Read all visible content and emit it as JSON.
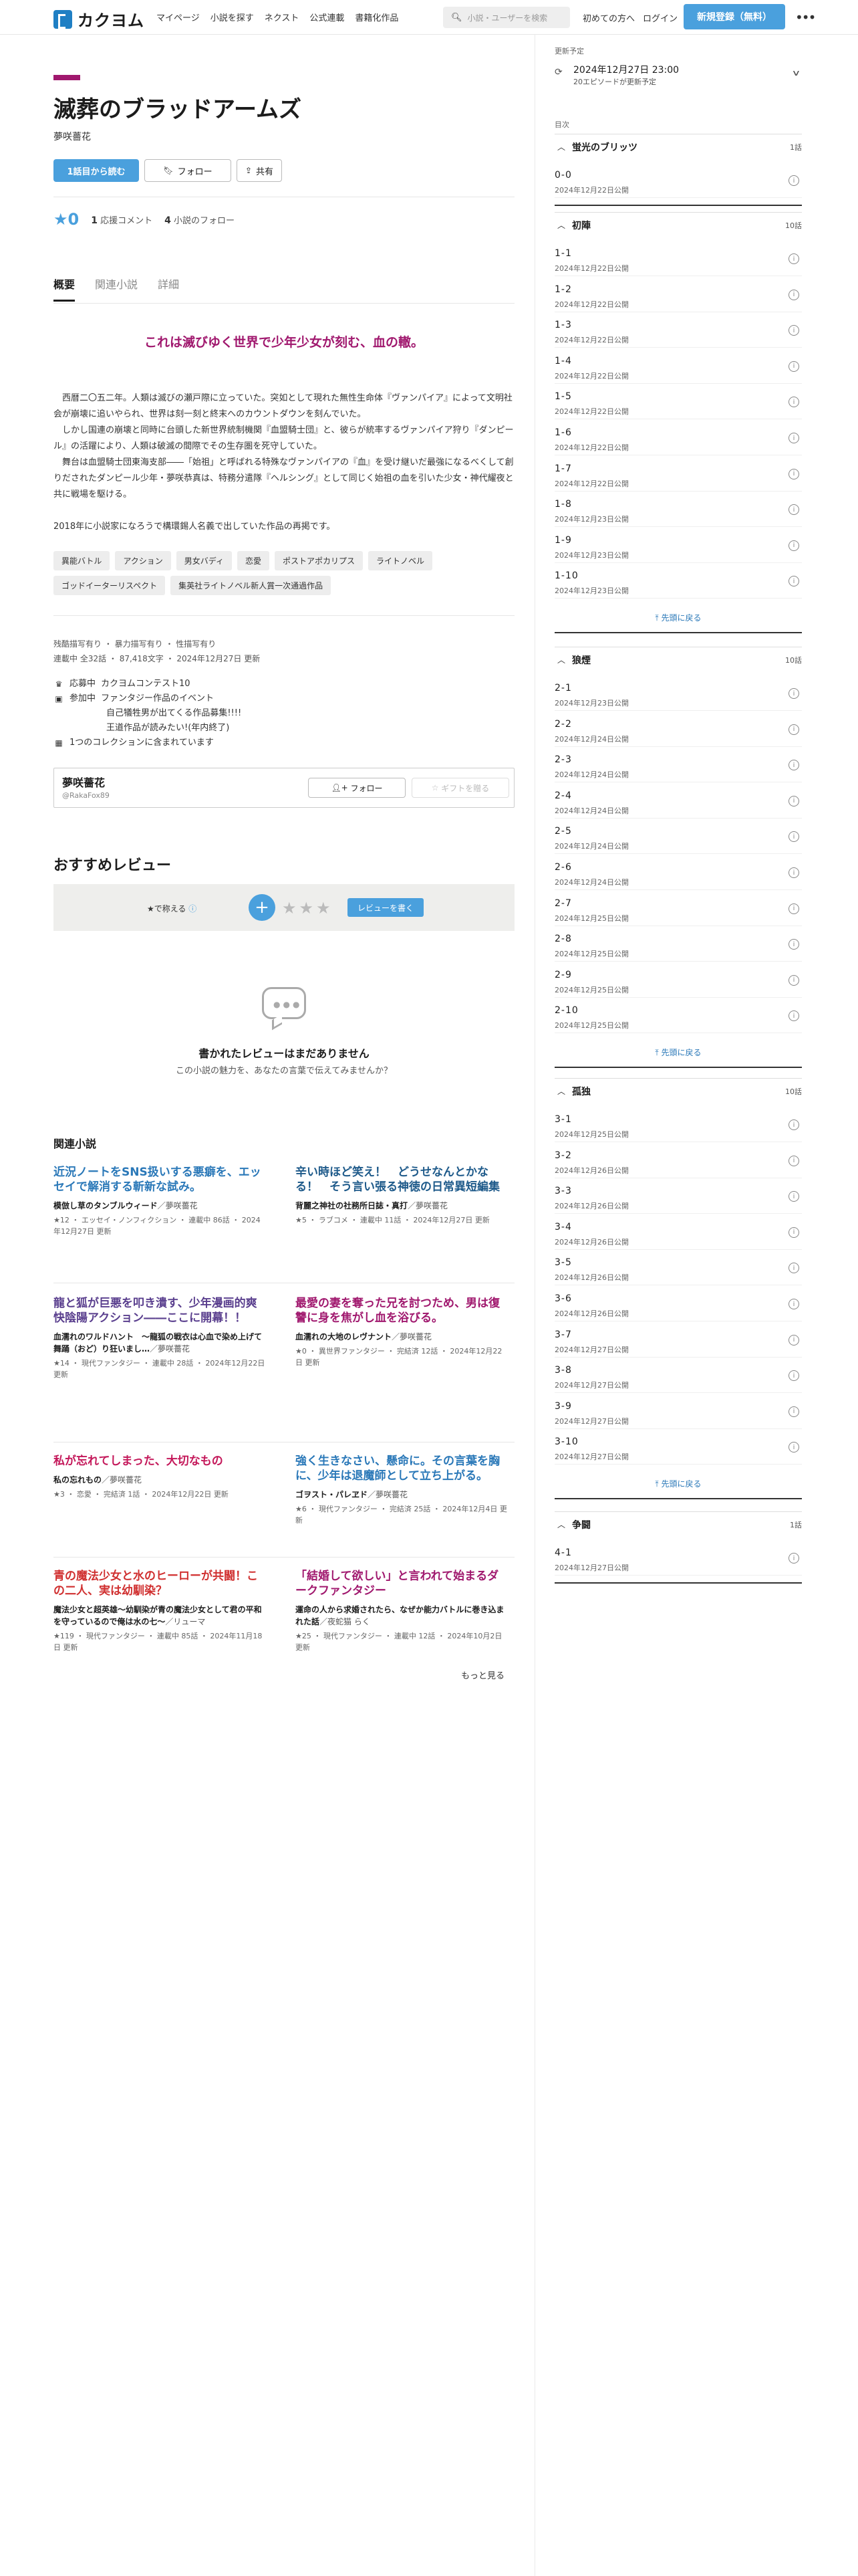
{
  "header": {
    "logo_text": "カクヨム",
    "nav": [
      "マイページ",
      "小説を探す",
      "ネクスト",
      "公式連載",
      "書籍化作品"
    ],
    "search_placeholder": "小説・ユーザーを検索",
    "first_time": "初めての方へ",
    "login": "ログイン",
    "register": "新規登録（無料）",
    "colors": {
      "accent": "#4aa0dd",
      "brand": "#1f7fc4",
      "genre": "#a0186e"
    }
  },
  "work": {
    "title": "滅葬のブラッドアームズ",
    "author": "夢咲薔花",
    "read_first": "1話目から読む",
    "follow": "フォロー",
    "share": "共有",
    "stars": "0",
    "comments_count": "1",
    "comments_label": "応援コメント",
    "followers_count": "4",
    "followers_label": "小説のフォロー"
  },
  "tabs": [
    "概要",
    "関連小説",
    "詳細"
  ],
  "summary": {
    "catchphrase": "これは滅びゆく世界で少年少女が刻む、血の轍。",
    "paragraphs": [
      "　西暦二〇五二年。人類は滅びの瀬戸際に立っていた。突如として現れた無性生命体『ヴァンパイア』によって文明社会が崩壊に追いやられ、世界は刻一刻と終末へのカウントダウンを刻んでいた。",
      "　しかし国連の崩壊と同時に台頭した新世界統制機関『血盟騎士団』と、彼らが統率するヴァンパイア狩り『ダンピール』の活躍により、人類は破滅の間際でその生存圏を死守していた。",
      "　舞台は血盟騎士団東海支部――「始祖」と呼ばれる特殊なヴァンパイアの『血』を受け継いだ最強になるべくして創りだされたダンピール少年・夢咲恭真は、特務分遣隊『ヘルシング』として同じく始祖の血を引いた少女・神代耀夜と共に戦場を駆ける。",
      "2018年に小説家になろうで構環錫人名義で出していた作品の再掲です。"
    ],
    "tags": [
      "異能バトル",
      "アクション",
      "男女バディ",
      "恋愛",
      "ポストアポカリプス",
      "ライトノベル",
      "ゴッドイーターリスペクト",
      "集英社ライトノベル新人賞一次通過作品"
    ]
  },
  "meta": {
    "warnings": "残酷描写有り ・ 暴力描写有り ・ 性描写有り",
    "status": "連載中 全32話 ・ 87,418文字 ・ 2024年12月27日 更新",
    "contest_label": "応募中",
    "contest": "カクヨムコンテスト10",
    "event_label": "参加中",
    "event_1": "ファンタジー作品のイベント",
    "event_2": "自己犠牲男が出てくる作品募集!!!!",
    "event_3": "王道作品が読みたい!(年内終了)",
    "collections": "1つのコレクションに含まれています"
  },
  "profile": {
    "name": "夢咲薔花",
    "id": "@RakaFox89",
    "follow": "フォロー",
    "gift": "ギフトを贈る"
  },
  "reviews": {
    "title": "おすすめレビュー",
    "label": "★で称える",
    "write": "レビューを書く",
    "empty_title": "書かれたレビューはまだありません",
    "empty_sub": "この小説の魅力を、あなたの言葉で伝えてみませんか？"
  },
  "related": {
    "title": "関連小説",
    "more": "もっと見る",
    "items": [
      {
        "title": "近況ノートをSNS扱いする悪癖を、エッセイで解消する斬新な試み。",
        "name": "模倣し草のタンブルウィード",
        "author": "／夢咲薔花",
        "meta": "★12 ・ エッセイ・ノンフィクション ・ 連載中 86話 ・ 2024年12月27日 更新",
        "color": "#2a78b8"
      },
      {
        "title": "辛い時ほど笑え！　どうせなんとかなる！　そう言い張る神徳の日常異短編集",
        "name": "背麗之神社の社務所日誌・真打",
        "author": "／夢咲薔花",
        "meta": "★5 ・ ラブコメ ・ 連載中 11話 ・ 2024年12月27日 更新",
        "color": "#1e5a8a"
      },
      {
        "title": "龍と狐が巨悪を叩き潰す、少年漫画的爽快陰陽アクション――ここに開幕！！",
        "name": "血濡れのワルドハント　～龍狐の戦衣は心血で染め上げて舞踊（おど）り狂いまし…",
        "author": "／夢咲薔花",
        "meta": "★14 ・ 現代ファンタジー ・ 連載中 28話 ・ 2024年12月22日 更新",
        "color": "#5a3f8e"
      },
      {
        "title": "最愛の妻を奪った兄を討つため、男は復讐に身を焦がし血を浴びる。",
        "name": "血濡れの大地のレヴナント",
        "author": "／夢咲薔花",
        "meta": "★0 ・ 異世界ファンタジー ・ 完結済 12話 ・ 2024年12月22日 更新",
        "color": "#a0186e"
      },
      {
        "title": "私が忘れてしまった、大切なもの",
        "name": "私の忘れもの",
        "author": "／夢咲薔花",
        "meta": "★3 ・ 恋愛 ・ 完結済 1話 ・ 2024年12月22日 更新",
        "color": "#c4185a"
      },
      {
        "title": "強く生きなさい、懸命に。その言葉を胸に、少年は退魔師として立ち上がる。",
        "name": "ゴヲスト・パレヱド",
        "author": "／夢咲薔花",
        "meta": "★6 ・ 現代ファンタジー ・ 完結済 25話 ・ 2024年12月4日 更新",
        "color": "#2a78b8"
      },
      {
        "title": "青の魔法少女と水のヒーローが共闘！この二人、実は幼馴染？",
        "name": "魔法少女と超英雄〜幼馴染が青の魔法少女として君の平和を守っているので俺は水の七〜",
        "author": "／リューマ",
        "meta": "★119 ・ 現代ファンタジー ・ 連載中 85話 ・ 2024年11月18日 更新",
        "color": "#d03030"
      },
      {
        "title": "「結婚して欲しい」と言われて始まるダークファンタジー",
        "name": "運命の人から求婚されたら、なぜか能力バトルに巻き込まれた話",
        "author": "／夜蛇猫 らく",
        "meta": "★25 ・ 現代ファンタジー ・ 連載中 12話 ・ 2024年10月2日 更新",
        "color": "#a0186e"
      }
    ]
  },
  "sidebar": {
    "schedule_label": "更新予定",
    "schedule_date": "2024年12月27日 23:00",
    "schedule_sub": "20エピソードが更新予定",
    "toc_label": "目次",
    "back_to_top": "先頭に戻る",
    "chapters": [
      {
        "name": "蛍光のブリッツ",
        "count": "1話",
        "episodes": [
          {
            "title": "0-0",
            "date": "2024年12月22日公開"
          }
        ]
      },
      {
        "name": "初陣",
        "count": "10話",
        "episodes": [
          {
            "title": "1-1",
            "date": "2024年12月22日公開"
          },
          {
            "title": "1-2",
            "date": "2024年12月22日公開"
          },
          {
            "title": "1-3",
            "date": "2024年12月22日公開"
          },
          {
            "title": "1-4",
            "date": "2024年12月22日公開"
          },
          {
            "title": "1-5",
            "date": "2024年12月22日公開"
          },
          {
            "title": "1-6",
            "date": "2024年12月22日公開"
          },
          {
            "title": "1-7",
            "date": "2024年12月22日公開"
          },
          {
            "title": "1-8",
            "date": "2024年12月23日公開"
          },
          {
            "title": "1-9",
            "date": "2024年12月23日公開"
          },
          {
            "title": "1-10",
            "date": "2024年12月23日公開"
          }
        ]
      },
      {
        "name": "狼煙",
        "count": "10話",
        "episodes": [
          {
            "title": "2-1",
            "date": "2024年12月23日公開"
          },
          {
            "title": "2-2",
            "date": "2024年12月24日公開"
          },
          {
            "title": "2-3",
            "date": "2024年12月24日公開"
          },
          {
            "title": "2-4",
            "date": "2024年12月24日公開"
          },
          {
            "title": "2-5",
            "date": "2024年12月24日公開"
          },
          {
            "title": "2-6",
            "date": "2024年12月24日公開"
          },
          {
            "title": "2-7",
            "date": "2024年12月25日公開"
          },
          {
            "title": "2-8",
            "date": "2024年12月25日公開"
          },
          {
            "title": "2-9",
            "date": "2024年12月25日公開"
          },
          {
            "title": "2-10",
            "date": "2024年12月25日公開"
          }
        ]
      },
      {
        "name": "孤独",
        "count": "10話",
        "episodes": [
          {
            "title": "3-1",
            "date": "2024年12月25日公開"
          },
          {
            "title": "3-2",
            "date": "2024年12月26日公開"
          },
          {
            "title": "3-3",
            "date": "2024年12月26日公開"
          },
          {
            "title": "3-4",
            "date": "2024年12月26日公開"
          },
          {
            "title": "3-5",
            "date": "2024年12月26日公開"
          },
          {
            "title": "3-6",
            "date": "2024年12月26日公開"
          },
          {
            "title": "3-7",
            "date": "2024年12月27日公開"
          },
          {
            "title": "3-8",
            "date": "2024年12月27日公開"
          },
          {
            "title": "3-9",
            "date": "2024年12月27日公開"
          },
          {
            "title": "3-10",
            "date": "2024年12月27日公開"
          }
        ]
      },
      {
        "name": "争闘",
        "count": "1話",
        "episodes": [
          {
            "title": "4-1",
            "date": "2024年12月27日公開"
          }
        ]
      }
    ]
  }
}
